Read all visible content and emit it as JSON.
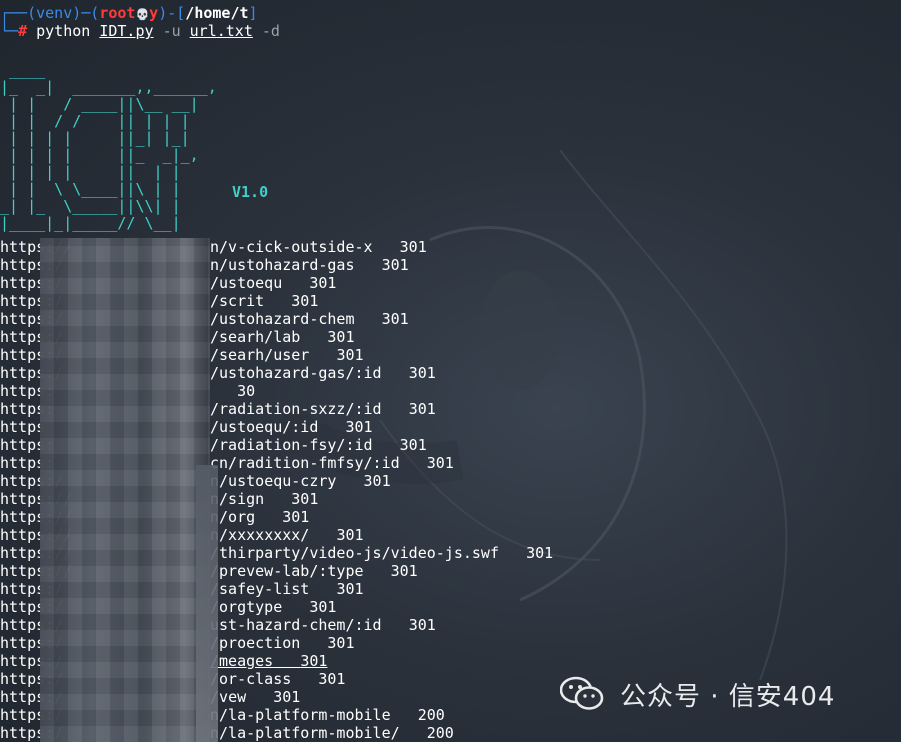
{
  "prompt": {
    "env": "(venv)",
    "user": "root",
    "skull": "💀",
    "host": "y",
    "path": "/home/t",
    "hash": "#",
    "command": "python",
    "script": "IDT.py",
    "flag_u": "-u",
    "file": "url.txt",
    "flag_d": "-d"
  },
  "banner": {
    "version": "V1.0"
  },
  "results": [
    {
      "prefix": "https://",
      "path": "n/v-c",
      "rest": "ick-outside-x",
      "status": "301"
    },
    {
      "prefix": "https:/",
      "path": "n/usto",
      "rest": "hazard-gas",
      "status": "301"
    },
    {
      "prefix": "https:/",
      "path": "/usto",
      "rest": "equ",
      "status": "301"
    },
    {
      "prefix": "https:/",
      "path": "/scri",
      "rest": "t",
      "status": "301"
    },
    {
      "prefix": "https:/",
      "path": "/usto",
      "rest": "hazard-chem",
      "status": "301"
    },
    {
      "prefix": "https:/",
      "path": "/sear",
      "rest": "h/lab",
      "status": "301"
    },
    {
      "prefix": "https:/",
      "path": "/sear",
      "rest": "h/user",
      "status": "301"
    },
    {
      "prefix": "https:/",
      "path": "/usto",
      "rest": "hazard-gas/:id",
      "status": "301"
    },
    {
      "prefix": "https:",
      "path": "",
      "rest": "",
      "status": "30"
    },
    {
      "prefix": "https:",
      "path": "/radi",
      "rest": "ation-sxzz/:id",
      "status": "301"
    },
    {
      "prefix": "https",
      "path": "/usto",
      "rest": "equ/:id",
      "status": "301"
    },
    {
      "prefix": "https:",
      "path": "/radi",
      "rest": "ation-fsy/:id",
      "status": "301"
    },
    {
      "prefix": "https:",
      "path": "cn/radi",
      "rest": "tion-fmfsy/:id",
      "status": "301"
    },
    {
      "prefix": "https:/",
      "path": "n/usto",
      "rest": "equ-czry",
      "status": "301"
    },
    {
      "prefix": "https://",
      "path": "n/sign",
      "rest": "",
      "status": "301"
    },
    {
      "prefix": "https://",
      "path": "n/org",
      "rest": "",
      "status": "301"
    },
    {
      "prefix": "https://",
      "path": "n/xxxx",
      "rest": "xxxx/",
      "status": "301"
    },
    {
      "prefix": "https://",
      "path": "/thir",
      "rest": "party/video-js/video-js.swf",
      "status": "301"
    },
    {
      "prefix": "https://",
      "path": "/prev",
      "rest": "ew-lab/:type",
      "status": "301"
    },
    {
      "prefix": "https:/",
      "path": "/safe",
      "rest": "y-list",
      "status": "301"
    },
    {
      "prefix": "https:/",
      "path": "/org",
      "rest": "type",
      "status": "301"
    },
    {
      "prefix": "https:/",
      "path": "ust",
      "rest": "-hazard-chem/:id",
      "status": "301"
    },
    {
      "prefix": "https:/",
      "path": "/pro",
      "rest": "ection",
      "status": "301"
    },
    {
      "prefix": "https:/",
      "path": "/me",
      "rest": "ages",
      "status": "301"
    },
    {
      "prefix": "https:/",
      "path": "/or",
      "rest": "-class",
      "status": "301"
    },
    {
      "prefix": "https:/",
      "path": "/v",
      "rest": "ew",
      "status": "301"
    },
    {
      "prefix": "https:/",
      "path": "n/la",
      "rest": "-platform-mobile",
      "status": "200"
    },
    {
      "prefix": "https:/",
      "path": "n/la",
      "rest": "-platform-mobile/",
      "status": "200"
    }
  ],
  "watermark": {
    "text": "公众号 · 信安404",
    "icon": "wechat-icon"
  }
}
